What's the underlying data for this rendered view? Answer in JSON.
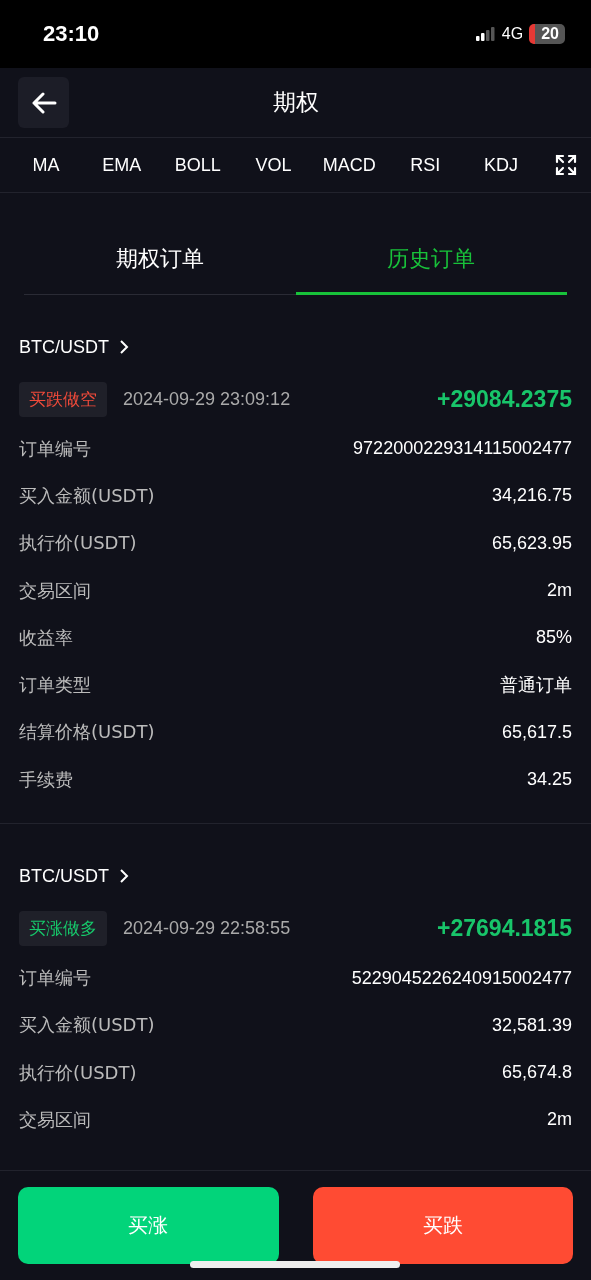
{
  "status_bar": {
    "time": "23:10",
    "network": "4G",
    "battery": "20"
  },
  "header": {
    "title": "期权"
  },
  "indicators": [
    "MA",
    "EMA",
    "BOLL",
    "VOL",
    "MACD",
    "RSI",
    "KDJ"
  ],
  "tabs": [
    {
      "label": "期权订单",
      "selected": false
    },
    {
      "label": "历史订单",
      "selected": true
    }
  ],
  "orders": [
    {
      "pair": "BTC/USDT",
      "kind": "short",
      "tag": "买跌做空",
      "time": "2024-09-29 23:09:12",
      "profit": "+29084.2375",
      "fields": [
        {
          "label": "订单编号",
          "value": "9722000229314115002477"
        },
        {
          "label": "买入金额(USDT)",
          "value": "34,216.75"
        },
        {
          "label": "执行价(USDT)",
          "value": "65,623.95"
        },
        {
          "label": "交易区间",
          "value": "2m"
        },
        {
          "label": "收益率",
          "value": "85%"
        },
        {
          "label": "订单类型",
          "value": "普通订单"
        },
        {
          "label": "结算价格(USDT)",
          "value": "65,617.5"
        },
        {
          "label": "手续费",
          "value": "34.25"
        }
      ]
    },
    {
      "pair": "BTC/USDT",
      "kind": "long",
      "tag": "买涨做多",
      "time": "2024-09-29 22:58:55",
      "profit": "+27694.1815",
      "fields": [
        {
          "label": "订单编号",
          "value": "5229045226240915002477"
        },
        {
          "label": "买入金额(USDT)",
          "value": "32,581.39"
        },
        {
          "label": "执行价(USDT)",
          "value": "65,674.8"
        },
        {
          "label": "交易区间",
          "value": "2m"
        }
      ]
    }
  ],
  "actions": [
    {
      "label": "买涨",
      "kind": "up"
    },
    {
      "label": "买跌",
      "kind": "down"
    }
  ]
}
